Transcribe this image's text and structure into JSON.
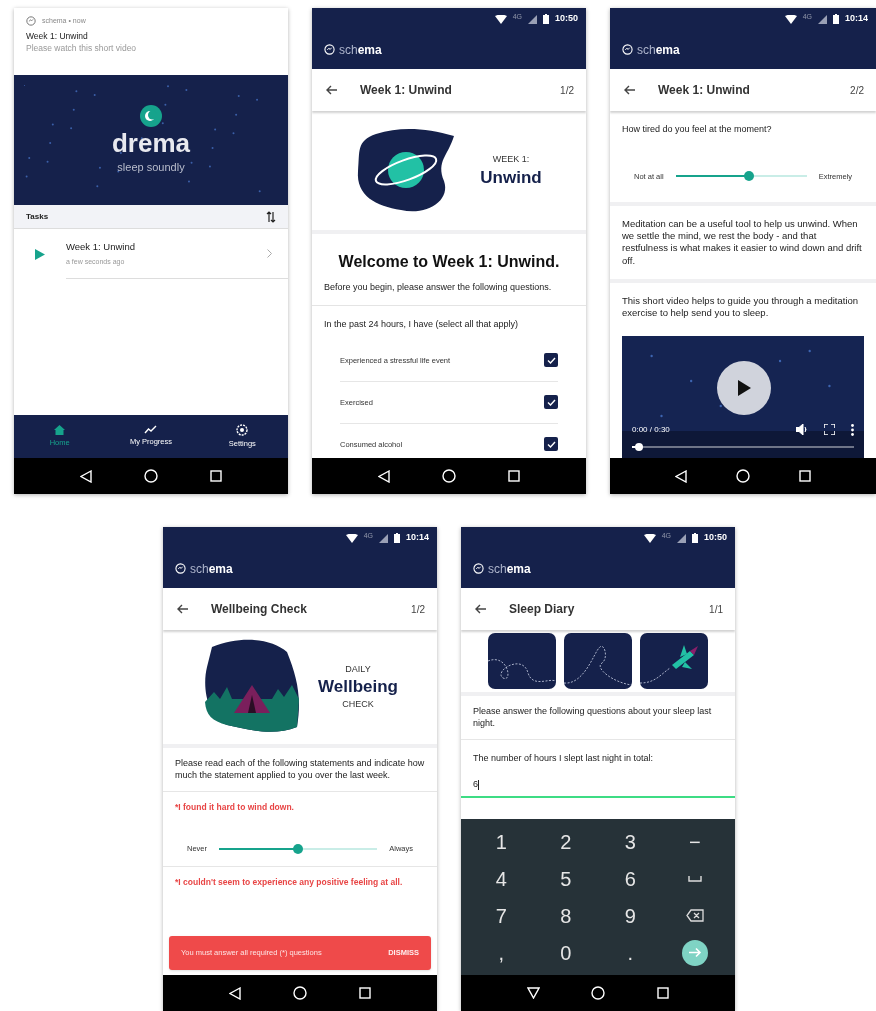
{
  "home": {
    "notification": {
      "app": "schema • now",
      "title": "Week 1: Unwind",
      "body": "Please watch this short video"
    },
    "hero": {
      "title": "drema",
      "tagline": "sleep soundly"
    },
    "tasks_header": "Tasks",
    "tasks": [
      {
        "title": "Week 1: Unwind",
        "time": "a few seconds ago"
      }
    ],
    "bottom_nav": [
      {
        "label": "Home",
        "kind": "home",
        "selected": true
      },
      {
        "label": "My Progress",
        "kind": "progress",
        "selected": false
      },
      {
        "label": "Settings",
        "kind": "settings",
        "selected": false
      }
    ],
    "system_nav": {
      "kind": "default"
    }
  },
  "week1_intro": {
    "status_bar": {
      "network": "4G",
      "time": "10:50"
    },
    "logo": "sch**ema**",
    "header": {
      "title": "Week 1: Unwind",
      "page": "1/2"
    },
    "banner": {
      "eyebrow": "WEEK 1:",
      "title": "Unwind"
    },
    "heading": "Welcome to Week 1: Unwind.",
    "intro": "Before you begin, please answer the following questions.",
    "question": "In the past 24 hours, I have (select all that apply)",
    "options": [
      {
        "label": "Experienced a stressful life event",
        "checked": true
      },
      {
        "label": "Exercised",
        "checked": true
      },
      {
        "label": "Consumed alcohol",
        "checked": true
      }
    ],
    "system_nav": {
      "kind": "default"
    }
  },
  "week1_video": {
    "status_bar": {
      "network": "4G",
      "time": "10:14"
    },
    "logo": "sch**ema**",
    "header": {
      "title": "Week 1: Unwind",
      "page": "2/2"
    },
    "question": "How tired do you feel at the moment?",
    "slider": {
      "min_label": "Not at all",
      "max_label": "Extremely",
      "level": 0.56
    },
    "paragraphs": [
      "Meditation can be a useful tool to help us unwind. When we settle the mind, we rest the body - and that restfulness is what makes it easier to wind down and drift off.",
      "This short video helps to guide you through a meditation exercise to help send you to sleep."
    ],
    "video": {
      "time": "0:00 / 0:30",
      "level": 0.03
    },
    "system_nav": {
      "kind": "default"
    }
  },
  "wellbeing": {
    "status_bar": {
      "network": "4G",
      "time": "10:14"
    },
    "logo": "sch**ema**",
    "header": {
      "title": "Wellbeing Check",
      "page": "1/2"
    },
    "banner": {
      "eyebrow": "DAILY",
      "title": "Wellbeing",
      "suffix": "CHECK"
    },
    "intro": "Please read each of the following statements and indicate how much the statement applied to you over the last week.",
    "questions": [
      {
        "text": "*I found it hard to wind down.",
        "slider": {
          "min_label": "Never",
          "max_label": "Always",
          "level": 0.5
        }
      },
      {
        "text": "*I couldn't seem to experience any positive feeling at all."
      }
    ],
    "snackbar": {
      "message": "You must answer all required (*) questions",
      "action": "DISMISS"
    },
    "system_nav": {
      "kind": "default"
    }
  },
  "sleep_diary": {
    "status_bar": {
      "network": "4G",
      "time": "10:50"
    },
    "logo": "sch**ema**",
    "header": {
      "title": "Sleep Diary",
      "page": "1/1"
    },
    "intro": "Please answer the following questions about your sleep last night.",
    "question": "The number of hours I slept last night in total:",
    "answer": "6",
    "keyboard": [
      {
        "kind": "key",
        "label": "1"
      },
      {
        "kind": "key",
        "label": "2"
      },
      {
        "kind": "key",
        "label": "3"
      },
      {
        "kind": "key",
        "label": "−"
      },
      {
        "kind": "key",
        "label": "4"
      },
      {
        "kind": "key",
        "label": "5"
      },
      {
        "kind": "key",
        "label": "6"
      },
      {
        "kind": "space"
      },
      {
        "kind": "key",
        "label": "7"
      },
      {
        "kind": "key",
        "label": "8"
      },
      {
        "kind": "key",
        "label": "9"
      },
      {
        "kind": "backspace"
      },
      {
        "kind": "key",
        "label": ","
      },
      {
        "kind": "key",
        "label": "0"
      },
      {
        "kind": "key",
        "label": "."
      },
      {
        "kind": "enter"
      }
    ],
    "system_nav": {
      "kind": "keyboard"
    }
  }
}
